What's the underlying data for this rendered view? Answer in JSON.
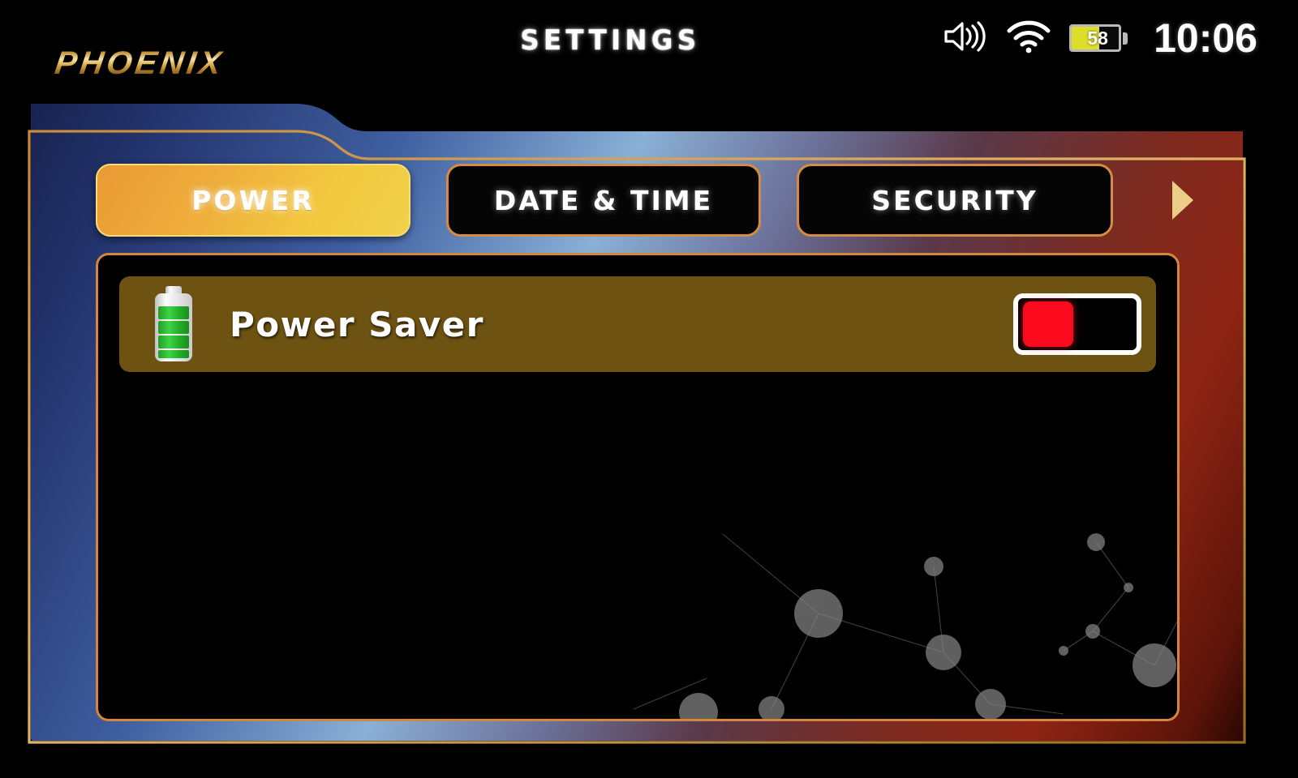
{
  "statusbar": {
    "logo": "PHOENIX",
    "title": "SETTINGS",
    "volume_icon": "speaker-volume-icon",
    "wifi_icon": "wifi-icon",
    "battery_percent": "58",
    "battery_level": 58,
    "battery_color": "#dede2a",
    "clock": "10:06"
  },
  "tabs": {
    "items": [
      {
        "label": "POWER",
        "active": true
      },
      {
        "label": "DATE & TIME",
        "active": false
      },
      {
        "label": "SECURITY",
        "active": false
      }
    ],
    "next_arrow_icon": "chevron-right-icon",
    "next_arrow_color": "#e9c87a"
  },
  "content": {
    "rows": [
      {
        "icon": "battery-full-green-icon",
        "label": "Power Saver",
        "control": "toggle",
        "state": "off",
        "knob_color": "#fb0a1e"
      }
    ]
  },
  "theme": {
    "accent": "#d6853a",
    "active_tab_gradient_start": "#ea9b35",
    "active_tab_gradient_end": "#f0d24a",
    "row_background": "#6e5212",
    "panel_background": "#000000"
  }
}
